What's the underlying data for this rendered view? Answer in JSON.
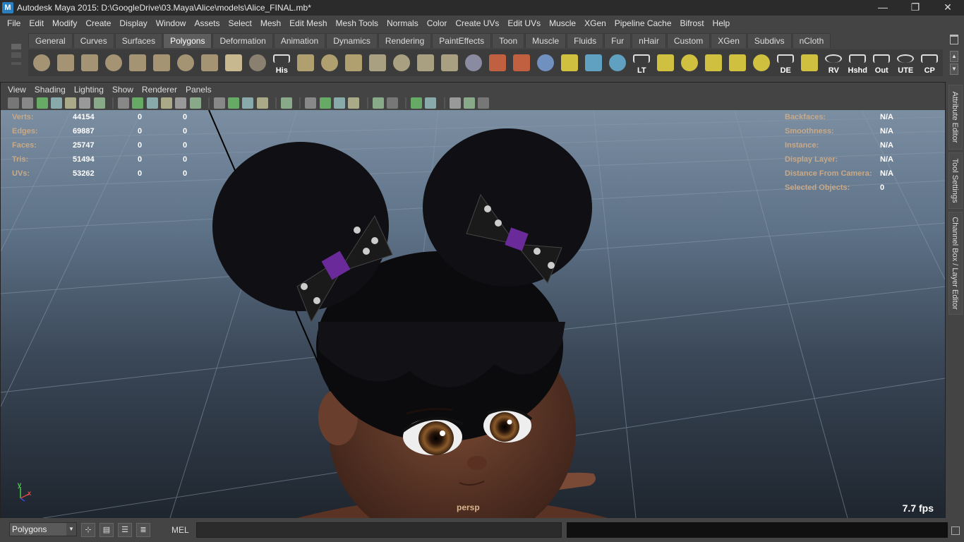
{
  "window": {
    "title": "Autodesk Maya 2015: D:\\GoogleDrive\\03.Maya\\Alice\\models\\Alice_FINAL.mb*",
    "controls": {
      "minimize": "—",
      "restore": "❐",
      "close": "✕"
    }
  },
  "menubar": [
    "File",
    "Edit",
    "Modify",
    "Create",
    "Display",
    "Window",
    "Assets",
    "Select",
    "Mesh",
    "Edit Mesh",
    "Mesh Tools",
    "Normals",
    "Color",
    "Create UVs",
    "Edit UVs",
    "Muscle",
    "XGen",
    "Pipeline Cache",
    "Bifrost",
    "Help"
  ],
  "shelf": {
    "tabs": [
      "General",
      "Curves",
      "Surfaces",
      "Polygons",
      "Deformation",
      "Animation",
      "Dynamics",
      "Rendering",
      "PaintEffects",
      "Toon",
      "Muscle",
      "Fluids",
      "Fur",
      "nHair",
      "Custom",
      "XGen",
      "Subdivs",
      "nCloth"
    ],
    "active_tab": "Polygons",
    "icons": [
      {
        "name": "poly-sphere-icon",
        "label": "",
        "color": "#a59474"
      },
      {
        "name": "poly-cube-icon",
        "label": "",
        "color": "#a59474"
      },
      {
        "name": "poly-cylinder-icon",
        "label": "",
        "color": "#a59474"
      },
      {
        "name": "poly-cone-icon",
        "label": "",
        "color": "#a59474"
      },
      {
        "name": "poly-plane-icon",
        "label": "",
        "color": "#a59474"
      },
      {
        "name": "poly-torus-icon",
        "label": "",
        "color": "#a59474"
      },
      {
        "name": "poly-pyramid-icon",
        "label": "",
        "color": "#a59474"
      },
      {
        "name": "poly-pipe-icon",
        "label": "",
        "color": "#a59474"
      },
      {
        "name": "poly-helix-icon",
        "label": "",
        "color": "#c8b890"
      },
      {
        "name": "soccer-ball-icon",
        "label": "",
        "color": "#8a8070"
      },
      {
        "name": "history-icon",
        "label": "His",
        "color": "#5c5c5c"
      },
      {
        "name": "poly-select-icon",
        "label": "",
        "color": "#b0a070"
      },
      {
        "name": "combine-icon",
        "label": "",
        "color": "#b0a070"
      },
      {
        "name": "separate-icon",
        "label": "",
        "color": "#b0a070"
      },
      {
        "name": "extrude-icon",
        "label": "",
        "color": "#a8a080"
      },
      {
        "name": "bridge-icon",
        "label": "",
        "color": "#a8a080"
      },
      {
        "name": "append-polygon-icon",
        "label": "",
        "color": "#a8a080"
      },
      {
        "name": "split-polygon-icon",
        "label": "",
        "color": "#a8a080"
      },
      {
        "name": "smooth-icon",
        "label": "",
        "color": "#8a8aa0"
      },
      {
        "name": "sculpt-icon",
        "label": "",
        "color": "#c06040"
      },
      {
        "name": "paint-brush-icon",
        "label": "",
        "color": "#c06040"
      },
      {
        "name": "wireframe-cube-icon",
        "label": "",
        "color": "#7090c0"
      },
      {
        "name": "soft-select-icon",
        "label": "",
        "color": "#d0c040"
      },
      {
        "name": "manipulator-icon",
        "label": "",
        "color": "#60a0c0"
      },
      {
        "name": "uv-editor-icon",
        "label": "",
        "color": "#60a0c0"
      },
      {
        "name": "lt-icon",
        "label": "LT",
        "color": "#5c5c5c"
      },
      {
        "name": "uv-layout-icon",
        "label": "",
        "color": "#d0c040"
      },
      {
        "name": "uv-unfold-icon",
        "label": "",
        "color": "#d0c040"
      },
      {
        "name": "uv-planar-icon",
        "label": "",
        "color": "#d0c040"
      },
      {
        "name": "uv-cut-icon",
        "label": "",
        "color": "#d0c040"
      },
      {
        "name": "uv-sew-icon",
        "label": "",
        "color": "#d0c040"
      },
      {
        "name": "de-icon",
        "label": "DE",
        "color": "#5c5c5c"
      },
      {
        "name": "uv-grid-icon",
        "label": "",
        "color": "#d0c040"
      },
      {
        "name": "rv-icon",
        "label": "RV",
        "color": "#5c5c5c"
      },
      {
        "name": "hshd-icon",
        "label": "Hshd",
        "color": "#5c5c5c"
      },
      {
        "name": "out-icon",
        "label": "Out",
        "color": "#5c5c5c"
      },
      {
        "name": "ute-icon",
        "label": "UTE",
        "color": "#5c5c5c"
      },
      {
        "name": "cp-icon",
        "label": "CP",
        "color": "#5c5c5c"
      }
    ]
  },
  "panel": {
    "menus": [
      "View",
      "Shading",
      "Lighting",
      "Show",
      "Renderer",
      "Panels"
    ],
    "toolbar_icons": [
      "camera-select-icon",
      "camera-attr-icon",
      "bookmark-icon",
      "image-plane-icon",
      "grease-pencil-icon",
      "film-gate-icon",
      "resolution-gate-icon",
      "sep",
      "wireframe-icon",
      "smooth-shade-icon",
      "default-material-icon",
      "textured-icon",
      "use-lights-icon",
      "shadows-icon",
      "sep",
      "isolate-select-icon",
      "xray-icon",
      "xray-joints-icon",
      "backface-icon",
      "sep",
      "grid-icon",
      "sep",
      "xray-active-icon",
      "ambient-occlusion-icon",
      "motion-blur-icon",
      "aa-icon",
      "sep",
      "exposure-icon",
      "gamma-icon",
      "sep",
      "hud-icon",
      "snap-icon",
      "sep",
      "camera-persp-icon",
      "camera-ortho-icon",
      "camera-mode-icon"
    ]
  },
  "hud": {
    "left_rows": [
      {
        "label": "Verts:",
        "v1": "44154",
        "v2": "0",
        "v3": "0"
      },
      {
        "label": "Edges:",
        "v1": "69887",
        "v2": "0",
        "v3": "0"
      },
      {
        "label": "Faces:",
        "v1": "25747",
        "v2": "0",
        "v3": "0"
      },
      {
        "label": "Tris:",
        "v1": "51494",
        "v2": "0",
        "v3": "0"
      },
      {
        "label": "UVs:",
        "v1": "53262",
        "v2": "0",
        "v3": "0"
      }
    ],
    "right_rows": [
      {
        "label": "Backfaces:",
        "value": "N/A"
      },
      {
        "label": "Smoothness:",
        "value": "N/A"
      },
      {
        "label": "Instance:",
        "value": "N/A"
      },
      {
        "label": "Display Layer:",
        "value": "N/A"
      },
      {
        "label": "Distance From Camera:",
        "value": "N/A"
      },
      {
        "label": "Selected Objects:",
        "value": "0"
      }
    ],
    "camera": "persp",
    "fps": "7.7 fps",
    "axis_y": "y",
    "axis_x": "x"
  },
  "side_tabs": [
    "Attribute Editor",
    "Tool Settings",
    "Channel Box / Layer Editor"
  ],
  "bottom": {
    "mode": "Polygons",
    "mode_arrow": "▼",
    "mel_label": "MEL"
  }
}
